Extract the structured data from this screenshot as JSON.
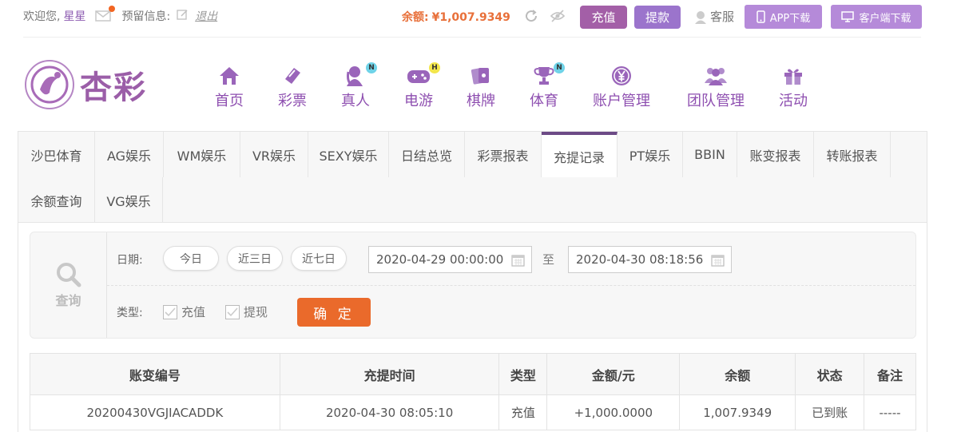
{
  "topbar": {
    "welcome": "欢迎您,",
    "username": "星星",
    "reserve_label": "预留信息:",
    "logout": "退出",
    "balance_label": "余额:",
    "balance_value": "¥1,007.9349",
    "recharge": "充值",
    "withdraw": "提款",
    "customer_service": "客服",
    "app_download": "APP下载",
    "client_download": "客户端下载"
  },
  "brand": {
    "logo_text": "杏彩"
  },
  "nav": [
    {
      "label": "首页",
      "icon": "home-icon"
    },
    {
      "label": "彩票",
      "icon": "lottery-ticket-icon"
    },
    {
      "label": "真人",
      "icon": "live-dealer-icon",
      "badge": "N"
    },
    {
      "label": "电游",
      "icon": "gamepad-icon",
      "badge": "H"
    },
    {
      "label": "棋牌",
      "icon": "cards-icon"
    },
    {
      "label": "体育",
      "icon": "trophy-icon",
      "badge": "N"
    },
    {
      "label": "账户管理",
      "icon": "yen-coin-icon"
    },
    {
      "label": "团队管理",
      "icon": "team-icon"
    },
    {
      "label": "活动",
      "icon": "gift-icon"
    }
  ],
  "tabs": [
    "沙巴体育",
    "AG娱乐",
    "WM娱乐",
    "VR娱乐",
    "SEXY娱乐",
    "日结总览",
    "彩票报表",
    "充提记录",
    "PT娱乐",
    "BBIN",
    "账变报表",
    "转账报表",
    "余额查询",
    "VG娱乐"
  ],
  "active_tab": "充提记录",
  "search": {
    "panel_label": "查询",
    "date_label": "日期:",
    "quick": [
      "今日",
      "近三日",
      "近七日"
    ],
    "start": "2020-04-29 00:00:00",
    "to": "至",
    "end": "2020-04-30 08:18:56",
    "type_label": "类型:",
    "type_recharge": "充值",
    "type_withdraw": "提现",
    "confirm": "确 定"
  },
  "table": {
    "headers": [
      "账变编号",
      "充提时间",
      "类型",
      "金额/元",
      "余额",
      "状态",
      "备注"
    ],
    "rows": [
      [
        "20200430VGJIACADDK",
        "2020-04-30 08:05:10",
        "充值",
        "+1,000.0000",
        "1,007.9349",
        "已到账",
        "-----"
      ]
    ]
  },
  "colors": {
    "brand_purple": "#9b5ea8",
    "accent_orange": "#ea6a2b",
    "positive_amount": "#d8312a",
    "status_ok": "#3a9c2e"
  }
}
